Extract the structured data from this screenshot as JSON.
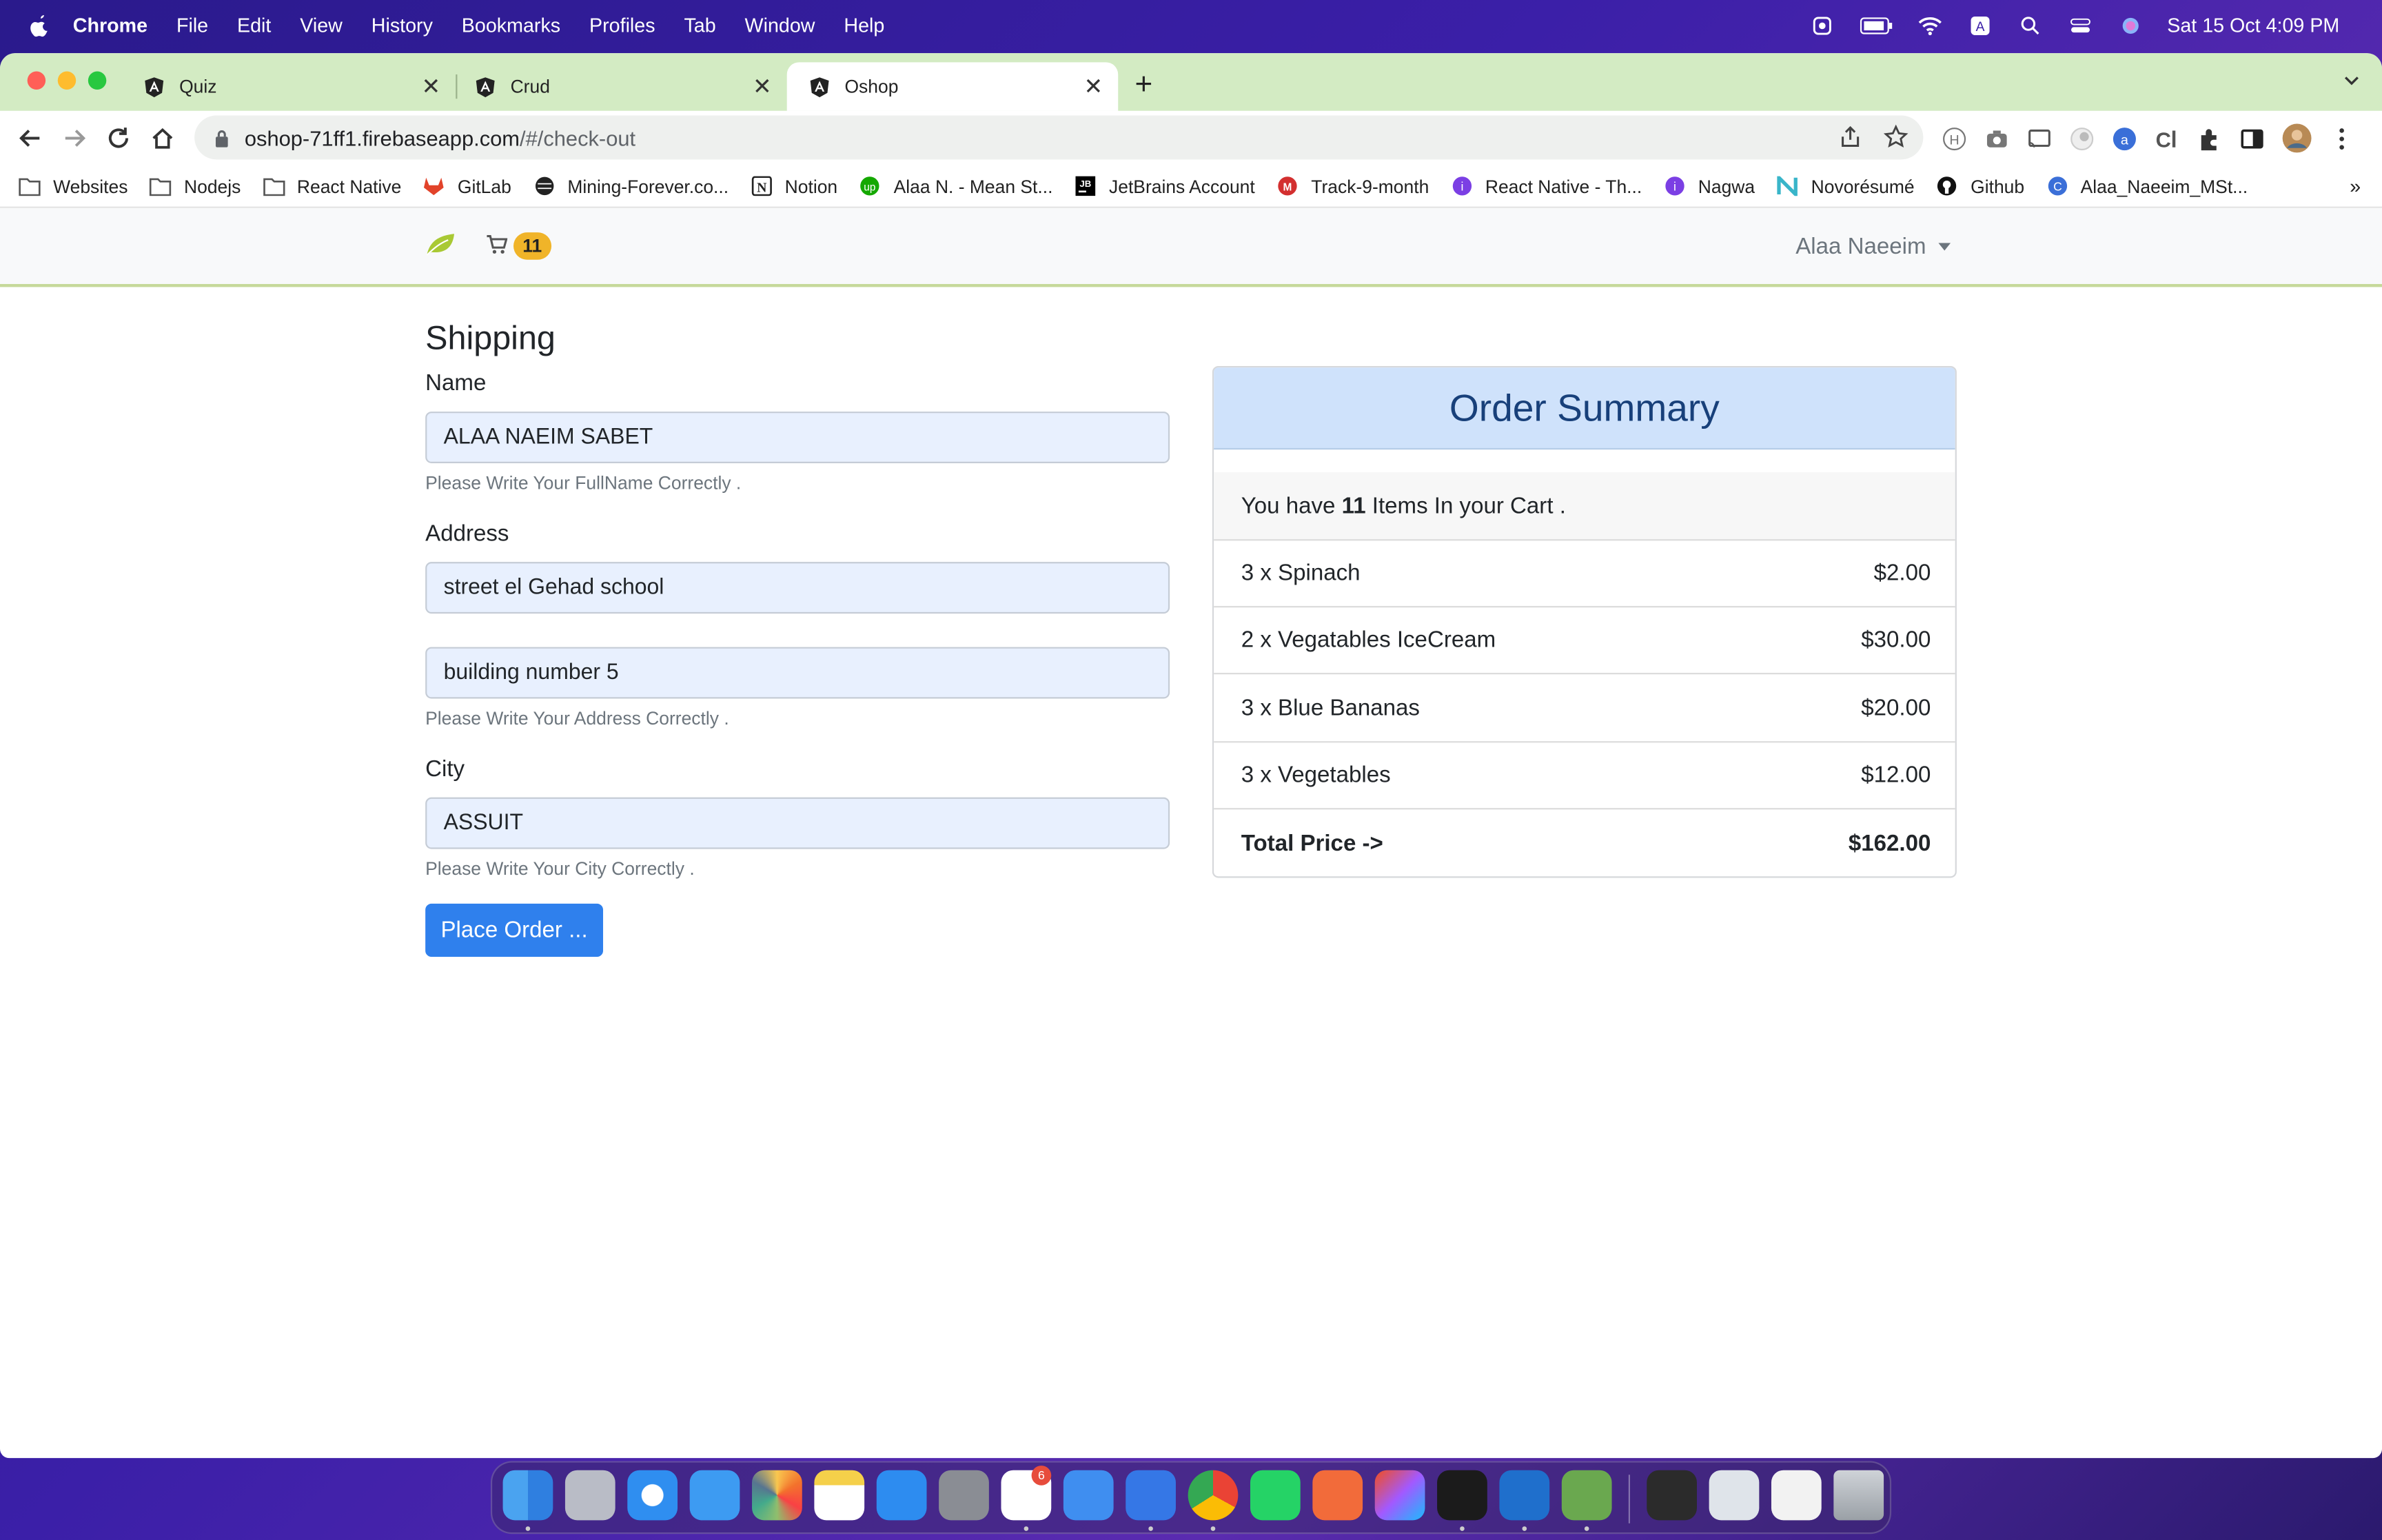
{
  "menubar": {
    "app": "Chrome",
    "items": [
      "File",
      "Edit",
      "View",
      "History",
      "Bookmarks",
      "Profiles",
      "Tab",
      "Window",
      "Help"
    ],
    "clock": "Sat 15 Oct  4:09 PM"
  },
  "tabs": [
    {
      "label": "Quiz",
      "icon": "angular-icon",
      "active": false
    },
    {
      "label": "Crud",
      "icon": "angular-icon",
      "active": false
    },
    {
      "label": "Oshop",
      "icon": "angular-icon",
      "active": true
    }
  ],
  "omnibox": {
    "host": "oshop-71ff1.firebaseapp.com",
    "path": "/#/check-out"
  },
  "bookmarks": [
    {
      "label": "Websites",
      "icon": "folder-icon"
    },
    {
      "label": "Nodejs",
      "icon": "folder-icon"
    },
    {
      "label": "React Native",
      "icon": "folder-icon"
    },
    {
      "label": "GitLab",
      "icon": "gitlab-icon"
    },
    {
      "label": "Mining-Forever.co...",
      "icon": "globe-icon"
    },
    {
      "label": "Notion",
      "icon": "notion-icon"
    },
    {
      "label": "Alaa N. - Mean St...",
      "icon": "upwork-icon"
    },
    {
      "label": "JetBrains Account",
      "icon": "jetbrains-icon"
    },
    {
      "label": "Track-9-month",
      "icon": "track-icon"
    },
    {
      "label": "React Native - Th...",
      "icon": "purple-icon"
    },
    {
      "label": "Nagwa",
      "icon": "purple-icon"
    },
    {
      "label": "Novorésumé",
      "icon": "novoresume-icon"
    },
    {
      "label": "Github",
      "icon": "github-icon"
    },
    {
      "label": "Alaa_Naeeim_MSt...",
      "icon": "cv-icon"
    }
  ],
  "bookmarks_more": "»",
  "navbar": {
    "cart_count": "11",
    "user_name": "Alaa Naeeim"
  },
  "shipping": {
    "title": "Shipping",
    "name_label": "Name",
    "name_value": "ALAA NAEIM SABET",
    "name_help": "Please Write Your FullName Correctly .",
    "address_label": "Address",
    "address_line1": "street el Gehad school",
    "address_line2": "building number 5",
    "address_help": "Please Write Your Address Correctly .",
    "city_label": "City",
    "city_value": "ASSUIT",
    "city_help": "Please Write Your City Correctly .",
    "submit_label": "Place Order ..."
  },
  "summary": {
    "title": "Order Summary",
    "count_prefix": "You have ",
    "count": "11",
    "count_suffix": " Items In your Cart .",
    "items": [
      {
        "label": "3 x Spinach",
        "price": "$2.00"
      },
      {
        "label": "2 x Vegatables IceCream",
        "price": "$30.00"
      },
      {
        "label": "3 x Blue Bananas",
        "price": "$20.00"
      },
      {
        "label": "3 x Vegetables",
        "price": "$12.00"
      }
    ],
    "total_label": "Total Price ->",
    "total_value": "$162.00"
  },
  "dock": {
    "apps": [
      "finder",
      "launchpad",
      "safari",
      "mail",
      "photos",
      "notes",
      "app-store",
      "system-preferences",
      "slack",
      "xcode",
      "simulator",
      "chrome",
      "whatsapp",
      "postman",
      "figma",
      "terminal",
      "vscode",
      "script-editor"
    ],
    "slack_badge": "6",
    "recents": [
      "recent-window-1",
      "recent-window-2",
      "recent-window-3",
      "trash"
    ]
  },
  "colors": {
    "accent": "#2f80ed",
    "tabstrip": "#d3ebc3",
    "summary_header": "#cfe2fb",
    "badge": "#f0b429"
  }
}
